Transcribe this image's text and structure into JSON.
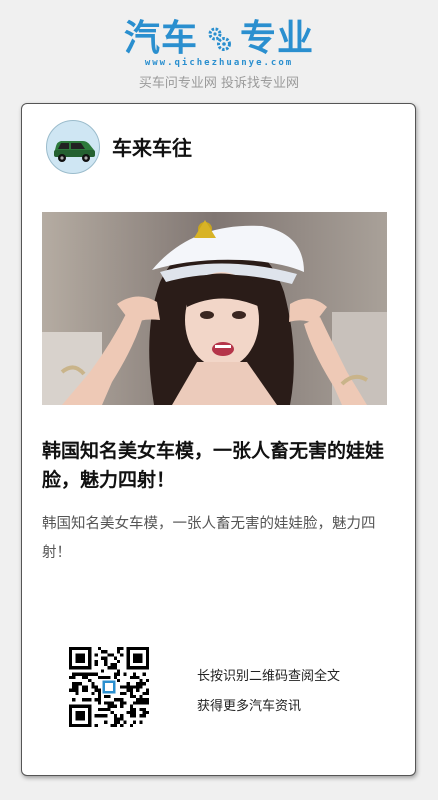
{
  "brand": {
    "name_left": "汽车",
    "name_right": "专业",
    "url": "www.qichezhuanye.com",
    "slogan": "买车问专业网 投诉找专业网",
    "color": "#2a8fcf"
  },
  "account": {
    "name": "车来车往",
    "avatar_icon": "green-car-icon"
  },
  "article": {
    "image_alt": "韩国知名美女车模",
    "title": "韩国知名美女车模，一张人畜无害的娃娃脸，魅力四射！",
    "summary": "韩国知名美女车模，一张人畜无害的娃娃脸，魅力四射！"
  },
  "qr": {
    "icon": "qr-code-icon",
    "hint_line1": "长按识别二维码查阅全文",
    "hint_line2": "获得更多汽车资讯"
  }
}
